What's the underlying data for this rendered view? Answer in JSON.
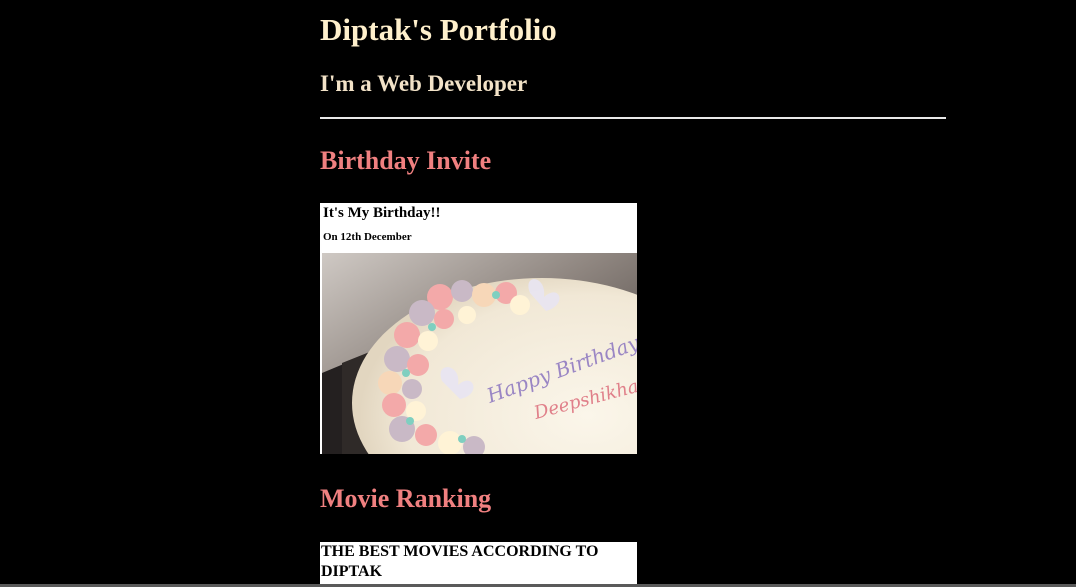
{
  "header": {
    "title": "Diptak's Portfolio",
    "subtitle": "I'm a Web Developer"
  },
  "sections": {
    "birthday": {
      "heading": "Birthday Invite",
      "card_title": "It's My Birthday!!",
      "card_date": "On 12th December",
      "cake_text_line1": "Happy Birthday",
      "cake_text_line2": "Deepshikha"
    },
    "movies": {
      "heading": "Movie Ranking",
      "card_title": "THE BEST MOVIES ACCORDING TO DIPTAK"
    }
  },
  "colors": {
    "background": "#000000",
    "title": "#fff0cc",
    "section_heading": "#f08080",
    "card_background": "#ffffff"
  }
}
